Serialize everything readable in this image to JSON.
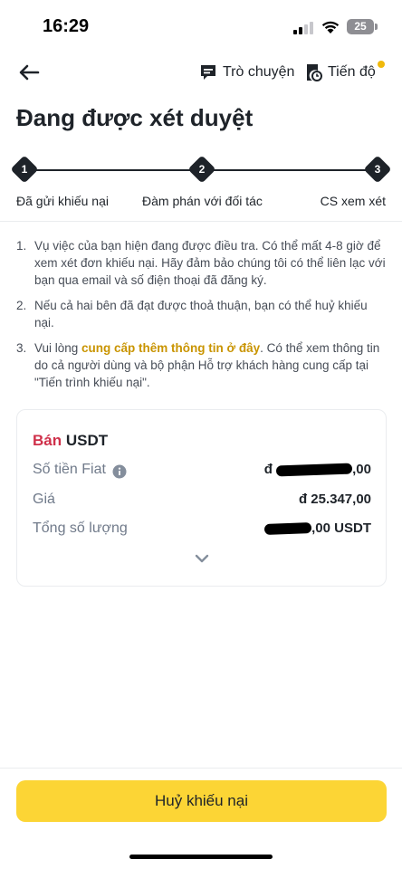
{
  "status_bar": {
    "time": "16:29",
    "battery": "25"
  },
  "header": {
    "chat_label": "Trò chuyện",
    "progress_label": "Tiến độ"
  },
  "page": {
    "title": "Đang được xét duyệt"
  },
  "stepper": {
    "steps": [
      {
        "number": "1",
        "label": "Đã gửi khiếu nại"
      },
      {
        "number": "2",
        "label": "Đàm phán với đối tác"
      },
      {
        "number": "3",
        "label": "CS xem xét"
      }
    ]
  },
  "notes": [
    {
      "num": "1.",
      "text": "Vụ việc của bạn hiện đang được điều tra. Có thể mất 4-8 giờ để xem xét đơn khiếu nại. Hãy đảm bảo chúng tôi có thể liên lạc với bạn qua email và số điện thoại đã đăng ký."
    },
    {
      "num": "2.",
      "text": "Nếu cả hai bên đã đạt được thoả thuận, bạn có thể huỷ khiếu nại."
    },
    {
      "num": "3.",
      "before": "Vui lòng ",
      "link": "cung cấp thêm thông tin ở đây",
      "after": ". Có thể xem thông tin do cả người dùng và bộ phận Hỗ trợ khách hàng cung cấp tại \"Tiến trình khiếu nại\"."
    }
  ],
  "order": {
    "side": "Bán",
    "asset": "USDT",
    "fiat_label": "Số tiền Fiat",
    "fiat_currency": "đ",
    "fiat_value_suffix": ",00",
    "price_label": "Giá",
    "price_value": "đ 25.347,00",
    "qty_label": "Tổng số lượng",
    "qty_value_suffix": ",00 USDT"
  },
  "actions": {
    "cancel_label": "Huỷ khiếu nại"
  },
  "colors": {
    "accent": "#fcd535",
    "link": "#c99400",
    "sell": "#cf304a"
  }
}
